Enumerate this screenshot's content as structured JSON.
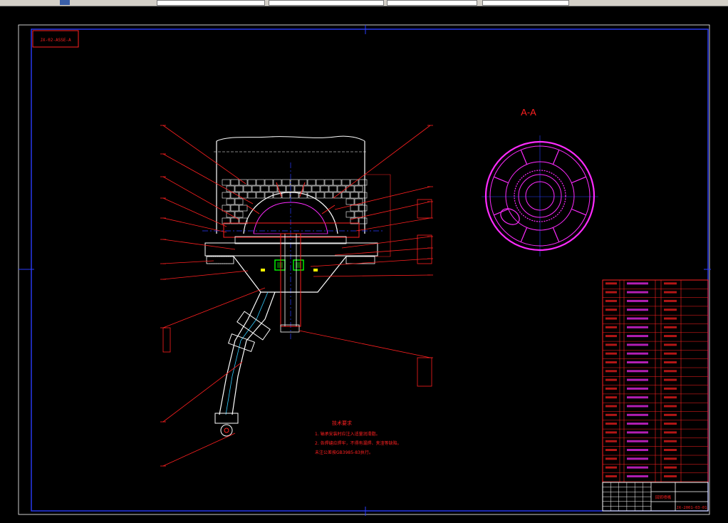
{
  "colors": {
    "background": "#000000",
    "frame": "#2a3cff",
    "red": "#ff2020",
    "white": "#ffffff",
    "magenta": "#ff2bff",
    "cyan": "#33ccff",
    "yellow": "#ffff00",
    "green": "#00ff00"
  },
  "icons": [
    "crosshair-cursor-icon"
  ],
  "drawing": {
    "title_stamp": "JX-02-ASSE-A",
    "section_label": "A-A",
    "notes_title": "技术要求",
    "notes": [
      "1. 轴承安装时应注入适量润滑脂。",
      "2. 各焊缝应焊牢，不得有漏焊、夹渣等缺陷。",
      "未注公差按GB3985-83执行。"
    ],
    "notes_standard": "GB3985-83",
    "drawing_number": "JX-2001-03-01",
    "title_block_name": "回转喷嘴"
  }
}
